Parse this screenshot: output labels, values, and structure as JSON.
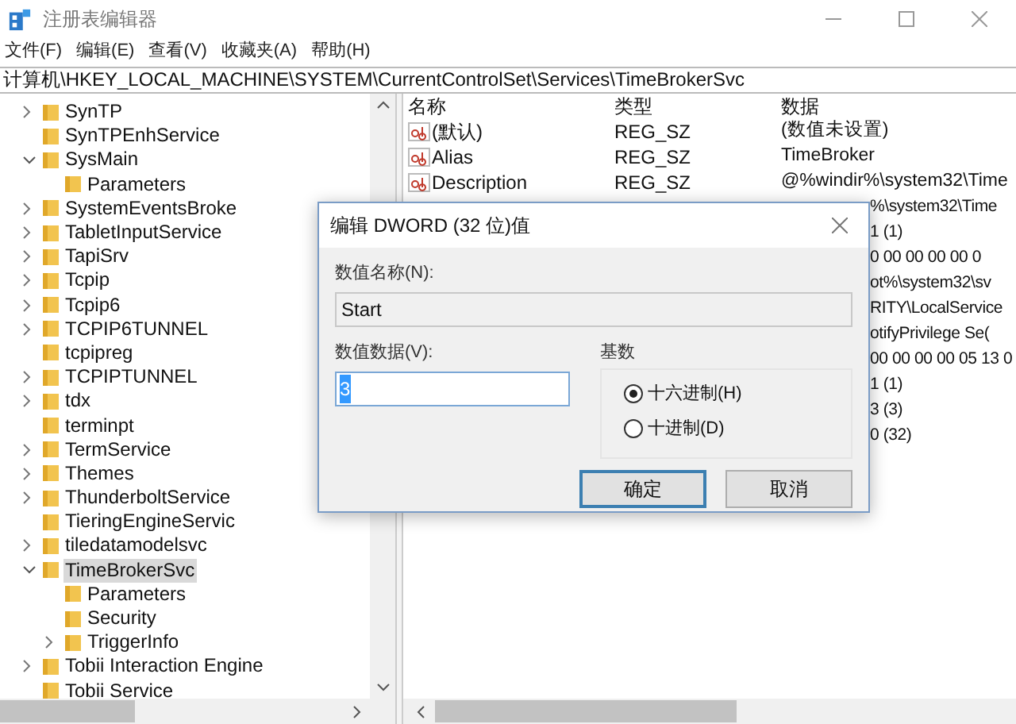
{
  "window": {
    "title": "注册表编辑器"
  },
  "menu": [
    "文件(F)",
    "编辑(E)",
    "查看(V)",
    "收藏夹(A)",
    "帮助(H)"
  ],
  "address": "计算机\\HKEY_LOCAL_MACHINE\\SYSTEM\\CurrentControlSet\\Services\\TimeBrokerSvc",
  "tree": [
    {
      "label": "SynTP",
      "kind": "closed",
      "selected": false
    },
    {
      "label": "SynTPEnhService",
      "kind": "leaf",
      "selected": false
    },
    {
      "label": "SysMain",
      "kind": "open",
      "selected": false,
      "children": [
        {
          "label": "Parameters",
          "kind": "leaf",
          "selected": false
        }
      ]
    },
    {
      "label": "SystemEventsBroke",
      "kind": "closed",
      "selected": false
    },
    {
      "label": "TabletInputService",
      "kind": "closed",
      "selected": false
    },
    {
      "label": "TapiSrv",
      "kind": "closed",
      "selected": false
    },
    {
      "label": "Tcpip",
      "kind": "closed",
      "selected": false
    },
    {
      "label": "Tcpip6",
      "kind": "closed",
      "selected": false
    },
    {
      "label": "TCPIP6TUNNEL",
      "kind": "closed",
      "selected": false
    },
    {
      "label": "tcpipreg",
      "kind": "leaf",
      "selected": false
    },
    {
      "label": "TCPIPTUNNEL",
      "kind": "closed",
      "selected": false
    },
    {
      "label": "tdx",
      "kind": "closed",
      "selected": false
    },
    {
      "label": "terminpt",
      "kind": "leaf",
      "selected": false
    },
    {
      "label": "TermService",
      "kind": "closed",
      "selected": false
    },
    {
      "label": "Themes",
      "kind": "closed",
      "selected": false
    },
    {
      "label": "ThunderboltService",
      "kind": "closed",
      "selected": false
    },
    {
      "label": "TieringEngineServic",
      "kind": "leaf",
      "selected": false
    },
    {
      "label": "tiledatamodelsvc",
      "kind": "closed",
      "selected": false
    },
    {
      "label": "TimeBrokerSvc",
      "kind": "open",
      "selected": true,
      "children": [
        {
          "label": "Parameters",
          "kind": "leaf",
          "selected": false
        },
        {
          "label": "Security",
          "kind": "leaf",
          "selected": false
        },
        {
          "label": "TriggerInfo",
          "kind": "closed",
          "selected": false
        }
      ]
    },
    {
      "label": "Tobii Interaction Engine",
      "kind": "closed",
      "selected": false
    },
    {
      "label": "Tobii Service",
      "kind": "leaf",
      "selected": false
    }
  ],
  "values": {
    "columns": [
      "名称",
      "类型",
      "数据"
    ],
    "rows": [
      {
        "kind": "full",
        "name": "(默认)",
        "type": "REG_SZ",
        "data": "(数值未设置)"
      },
      {
        "kind": "full",
        "name": "Alias",
        "type": "REG_SZ",
        "data": "TimeBroker"
      },
      {
        "kind": "full",
        "name": "Description",
        "type": "REG_SZ",
        "data": "@%windir%\\system32\\Time"
      },
      {
        "kind": "covered",
        "data": "%\\system32\\Time"
      },
      {
        "kind": "covered",
        "data": "1 (1)"
      },
      {
        "kind": "covered",
        "data": "0 00 00 00 00 0"
      },
      {
        "kind": "covered",
        "data": "ot%\\system32\\sv"
      },
      {
        "kind": "covered",
        "data": "RITY\\LocalService"
      },
      {
        "kind": "covered",
        "data": "otifyPrivilege Se("
      },
      {
        "kind": "covered",
        "data": "00 00 00 00 05 13 0"
      },
      {
        "kind": "covered",
        "data": "1 (1)"
      },
      {
        "kind": "covered",
        "data": "3 (3)"
      },
      {
        "kind": "covered",
        "data": "0 (32)"
      }
    ]
  },
  "dialog": {
    "title": "编辑 DWORD (32 位)值",
    "name_label": "数值名称(N):",
    "name_value": "Start",
    "data_label": "数值数据(V):",
    "data_value": "3",
    "base_label": "基数",
    "radios": [
      {
        "label": "十六进制(H)",
        "selected": true
      },
      {
        "label": "十进制(D)",
        "selected": false
      }
    ],
    "buttons": [
      {
        "label": "确定",
        "default": true
      },
      {
        "label": "取消",
        "default": false
      }
    ]
  }
}
